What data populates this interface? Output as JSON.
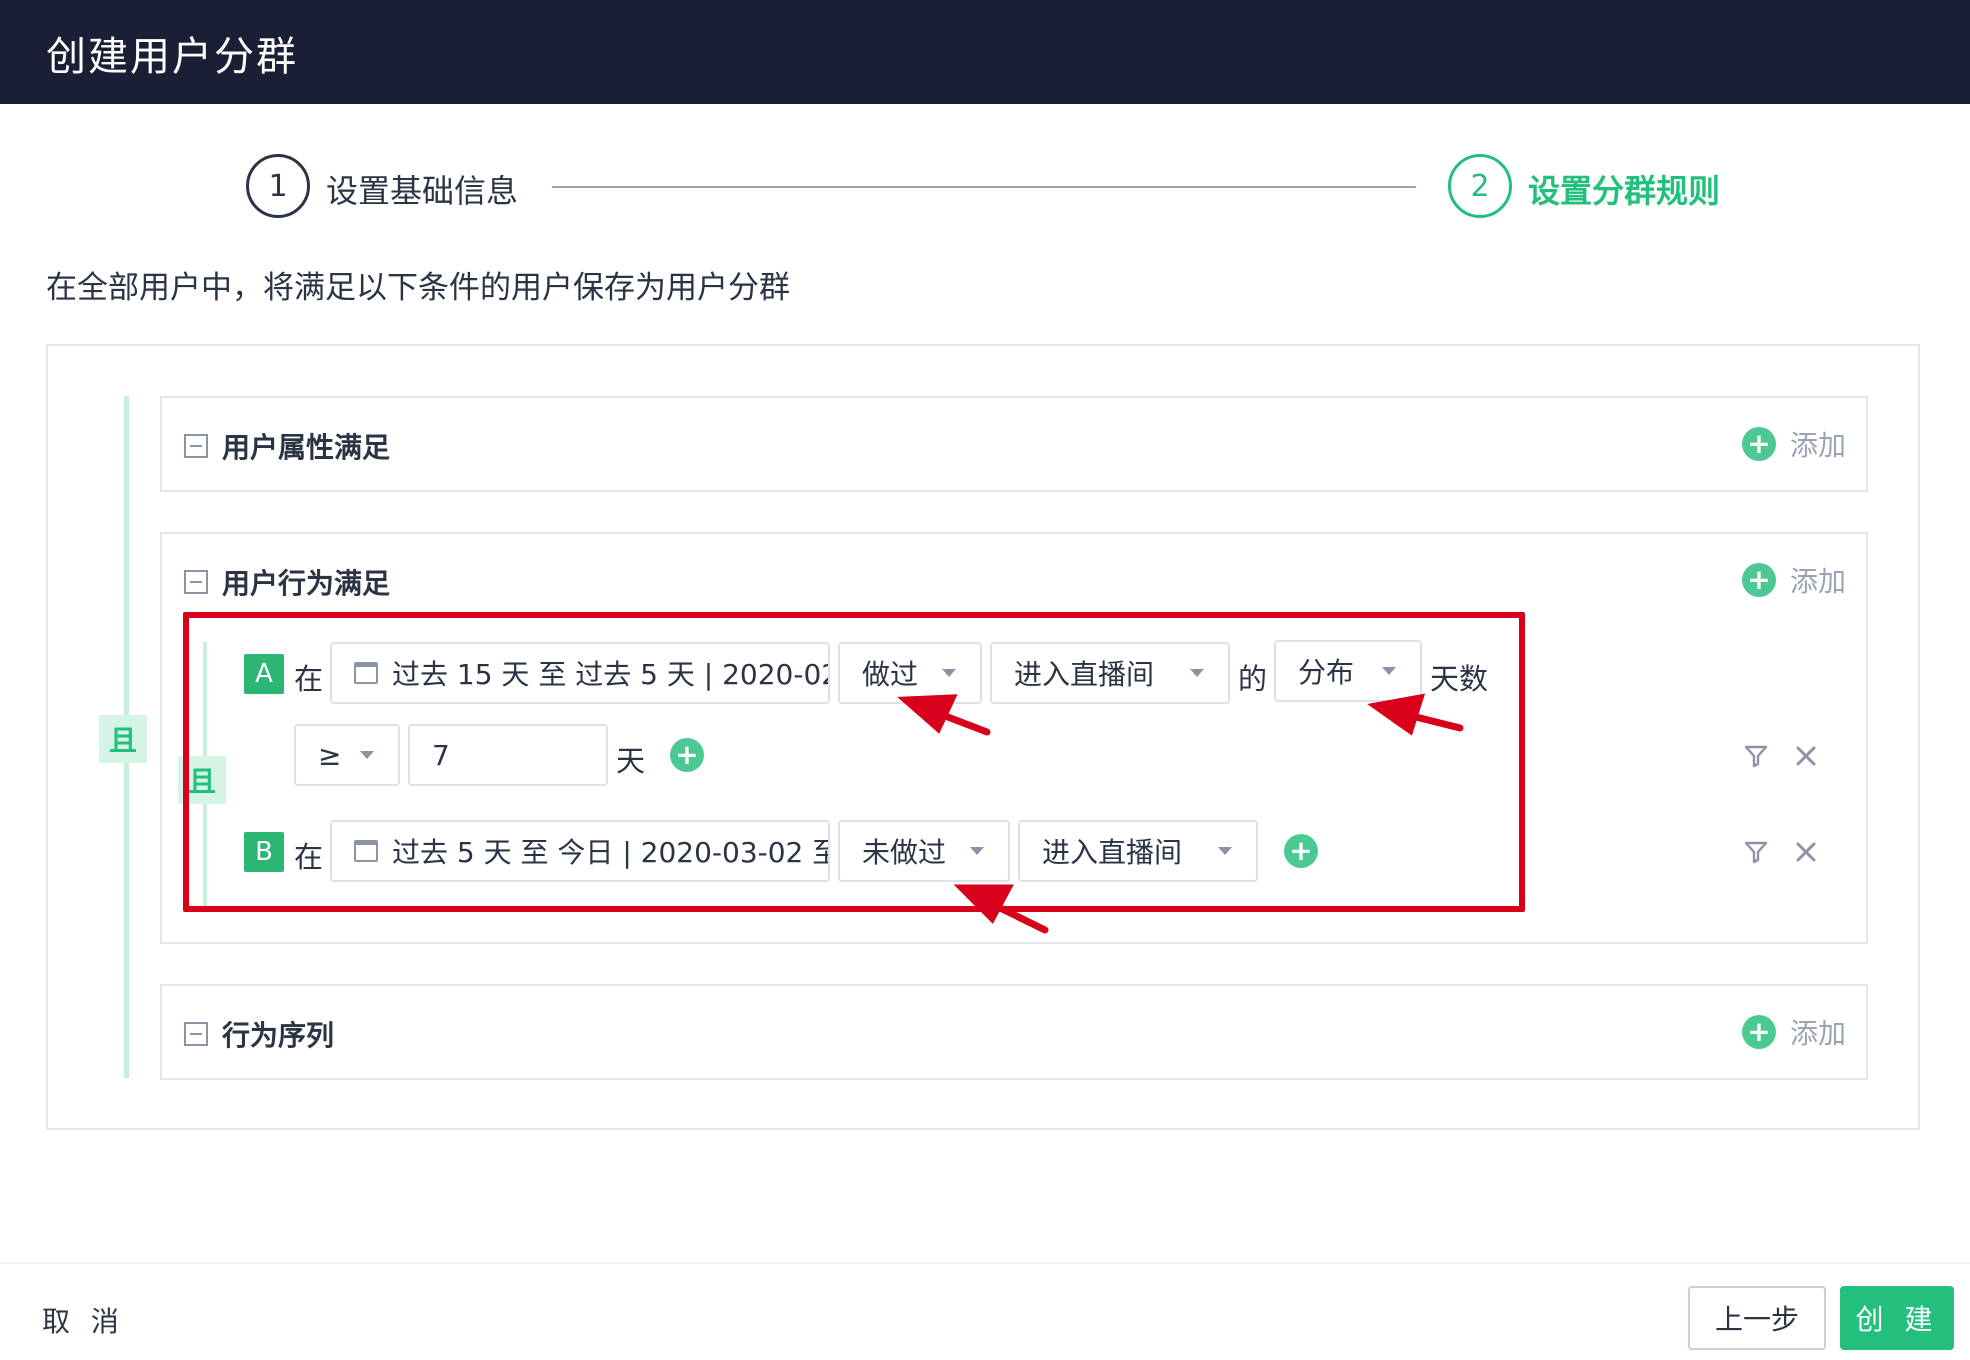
{
  "header": {
    "title": "创建用户分群"
  },
  "steps": [
    {
      "number": "1",
      "label": "设置基础信息",
      "active": false
    },
    {
      "number": "2",
      "label": "设置分群规则",
      "active": true
    }
  ],
  "subtitle": "在全部用户中，将满足以下条件的用户保存为用户分群",
  "logic": {
    "and_label": "且"
  },
  "sections": {
    "attributes": {
      "title": "用户属性满足",
      "add_label": "添加"
    },
    "behavior": {
      "title": "用户行为满足",
      "add_label": "添加"
    },
    "sequence": {
      "title": "行为序列",
      "add_label": "添加"
    }
  },
  "rules": {
    "a": {
      "letter": "A",
      "prefix": "在",
      "date_range": "过去 15 天 至 过去 5 天 | 2020-02",
      "action": "做过",
      "event": "进入直播间",
      "connector": "的",
      "metric": "分布",
      "metric_suffix": "天数",
      "operator": "≥",
      "value": "7",
      "unit": "天"
    },
    "b": {
      "letter": "B",
      "prefix": "在",
      "date_range": "过去 5 天 至 今日 | 2020-03-02 至",
      "action": "未做过",
      "event": "进入直播间"
    }
  },
  "footer": {
    "cancel_label": "取 消",
    "prev_label": "上一步",
    "create_label": "创 建"
  },
  "colors": {
    "header_bg": "#1a1f36",
    "accent": "#23c07d",
    "highlight": "#d9001b"
  },
  "icons": [
    "calendar-icon",
    "filter-icon",
    "close-icon",
    "plus-circle-icon",
    "chevron-down-icon",
    "collapse-icon"
  ]
}
